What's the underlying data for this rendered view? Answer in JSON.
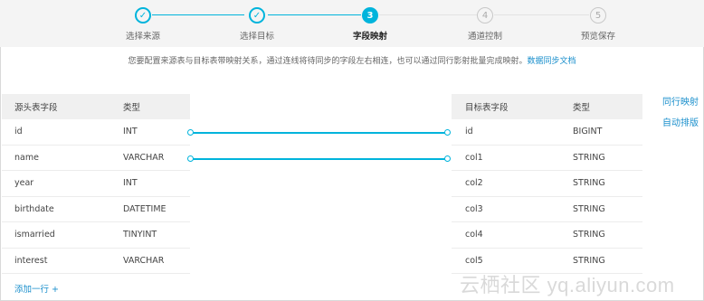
{
  "steps": [
    {
      "num": "✓",
      "label": "选择来源",
      "state": "done"
    },
    {
      "num": "✓",
      "label": "选择目标",
      "state": "done"
    },
    {
      "num": "3",
      "label": "字段映射",
      "state": "active"
    },
    {
      "num": "4",
      "label": "通道控制",
      "state": "todo"
    },
    {
      "num": "5",
      "label": "预览保存",
      "state": "todo"
    }
  ],
  "tip": {
    "text": "您要配置来源表与目标表带映射关系，通过连线将待同步的字段左右相连，也可以通过同行影射批量完成映射。",
    "link": "数据同步文档"
  },
  "source_table": {
    "headers": [
      "源头表字段",
      "类型"
    ],
    "rows": [
      [
        "id",
        "INT"
      ],
      [
        "name",
        "VARCHAR"
      ],
      [
        "year",
        "INT"
      ],
      [
        "birthdate",
        "DATETIME"
      ],
      [
        "ismarried",
        "TINYINT"
      ],
      [
        "interest",
        "VARCHAR"
      ]
    ]
  },
  "target_table": {
    "headers": [
      "目标表字段",
      "类型"
    ],
    "rows": [
      [
        "id",
        "BIGINT"
      ],
      [
        "col1",
        "STRING"
      ],
      [
        "col2",
        "STRING"
      ],
      [
        "col3",
        "STRING"
      ],
      [
        "col4",
        "STRING"
      ],
      [
        "col5",
        "STRING"
      ]
    ]
  },
  "add_row_label": "添加一行 +",
  "side_actions": {
    "same_row": "同行映射",
    "auto_sort": "自动排版"
  },
  "watermark": "云栖社区 yq.aliyun.com",
  "colors": {
    "accent": "#00b4dc",
    "link": "#1a8fcc"
  }
}
